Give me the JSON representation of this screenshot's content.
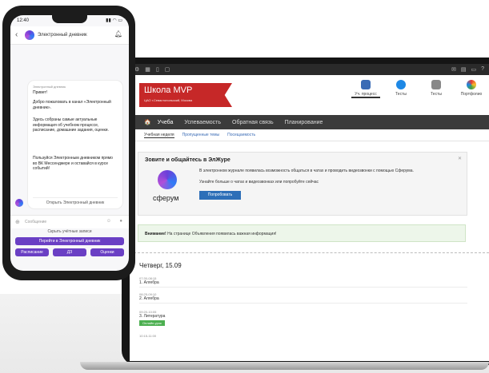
{
  "phone": {
    "status_time": "12:40",
    "status_icons": "▮▮ ◠ ▭",
    "chat_title": "Электронный дневник",
    "message": {
      "sender": "Электронный дневник",
      "greeting": "Привет!",
      "p1": "Добро пожаловать в канал «Электронный дневник».",
      "p2": "Здесь собраны самые актуальные информация об учебном процессе, расписание, домашние задания, оценки.",
      "p3": "Пользуйся Электронным дневником прямо во ВК Мессенджере и оставайся в курсе событий!",
      "button": "Открыть Электронный дневник"
    },
    "compose_placeholder": "Сообщение",
    "switch_keyboard": "Скрыть учётные записи",
    "main_button": "Перейти в Электронный дневник",
    "small_buttons": [
      "Расписание",
      "ДЗ",
      "Оценки"
    ]
  },
  "laptop": {
    "school_name": "Школа MVP",
    "school_sub": "ЦАО г.Севастопольский, Москва",
    "header_icons": [
      {
        "label": "Уч. процесс",
        "color": "#3a6bb5"
      },
      {
        "label": "Тесты",
        "color": "#1e88e5"
      },
      {
        "label": "Тесты",
        "color": "#888888"
      },
      {
        "label": "Портфолио",
        "color": "#f39c12"
      }
    ],
    "nav": {
      "home": "🏠",
      "items": [
        "Учеба",
        "Успеваемость",
        "Обратная связь",
        "Планирование"
      ]
    },
    "sub_tabs": [
      "Учебная неделя",
      "Пропущенные темы",
      "Посещаемость"
    ],
    "card": {
      "title": "Зовите и общайтесь в ЭлЖуре",
      "brand": "сферум",
      "text": "В электронном журнале появилась возможность общаться в чатах и проводить видеозвонки с помощью Сферума.",
      "text2": "Узнайте больше о чатах и видеозвонках или попробуйте сейчас",
      "button": "Попробовать"
    },
    "notice": {
      "bold": "Внимание!",
      "text": "На странице Объявления появилась важная информация!"
    },
    "day": "Четверг, 15.09",
    "lessons": [
      {
        "time": "07:30-08:15",
        "num": "1.",
        "name": "Алгебра",
        "badge": ""
      },
      {
        "time": "08:25-09:10",
        "num": "2.",
        "name": "Алгебра",
        "badge": ""
      },
      {
        "time": "09:20-10:05",
        "num": "3.",
        "name": "Литература",
        "badge": "Онлайн-урок"
      },
      {
        "time": "10:15-11:00",
        "num": "",
        "name": "",
        "badge": ""
      }
    ]
  }
}
